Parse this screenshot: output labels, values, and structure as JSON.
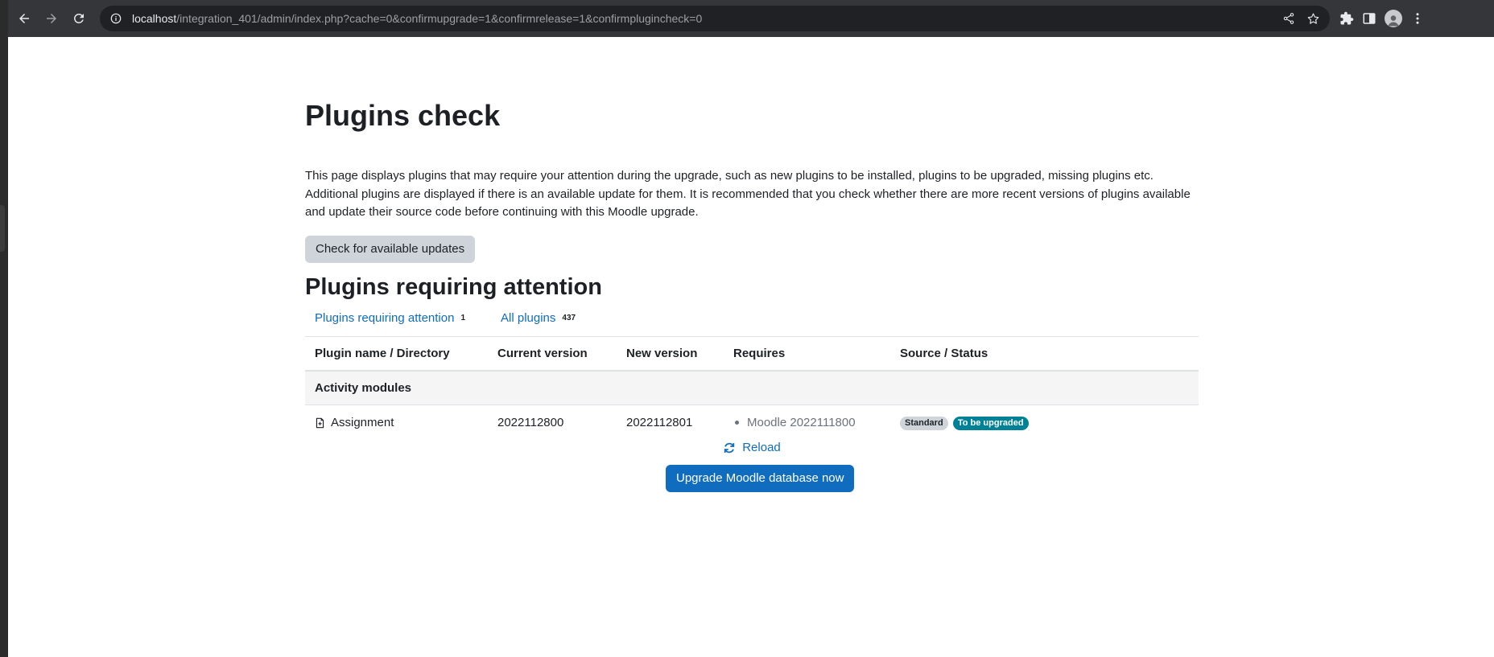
{
  "browser": {
    "url_host": "localhost",
    "url_path": "/integration_401/admin/index.php?cache=0&confirmupgrade=1&confirmrelease=1&confirmplugincheck=0"
  },
  "page": {
    "title": "Plugins check",
    "description": "This page displays plugins that may require your attention during the upgrade, such as new plugins to be installed, plugins to be upgraded, missing plugins etc. Additional plugins are displayed if there is an available update for them. It is recommended that you check whether there are more recent versions of plugins available and update their source code before continuing with this Moodle upgrade.",
    "check_button": "Check for available updates",
    "section_title": "Plugins requiring attention",
    "tabs": [
      {
        "label": "Plugins requiring attention",
        "count": "1"
      },
      {
        "label": "All plugins",
        "count": "437"
      }
    ],
    "table": {
      "headers": [
        "Plugin name / Directory",
        "Current version",
        "New version",
        "Requires",
        "Source / Status"
      ],
      "group": "Activity modules",
      "rows": [
        {
          "name": "Assignment",
          "current": "2022112800",
          "new": "2022112801",
          "requires": "Moodle 2022111800",
          "source": "Standard",
          "status": "To be upgraded"
        }
      ]
    },
    "reload_label": "Reload",
    "upgrade_button": "Upgrade Moodle database now"
  },
  "colors": {
    "link": "#0f6cbf",
    "status_badge": "#008196",
    "source_badge": "#ced4da"
  }
}
